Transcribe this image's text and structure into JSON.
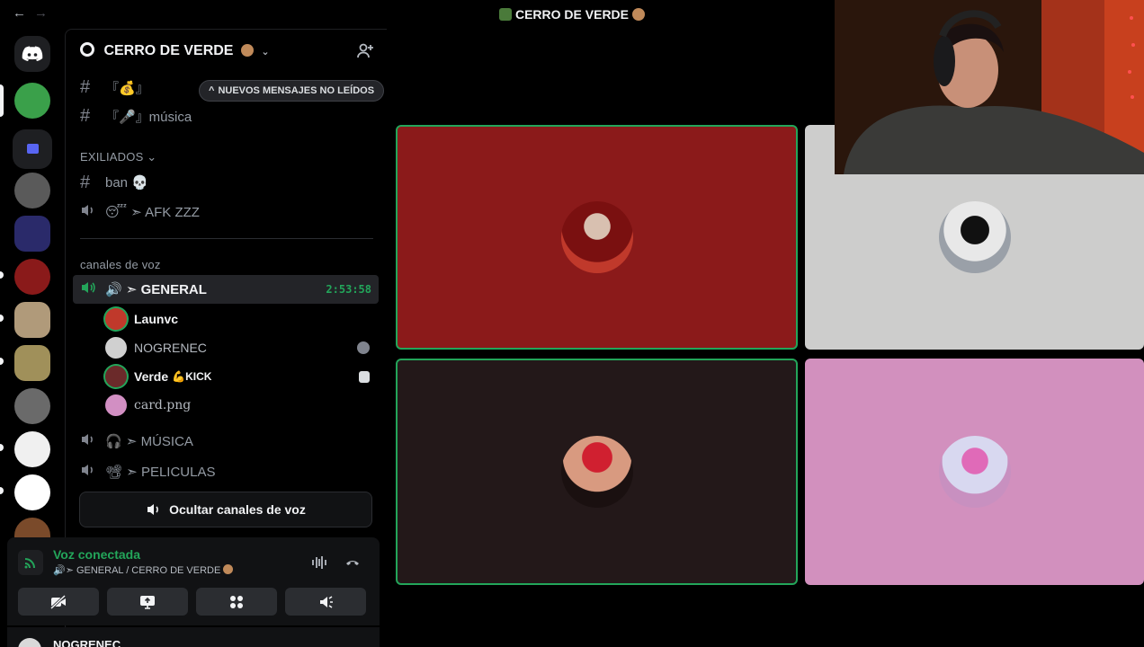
{
  "nav": {
    "back": "←",
    "forward": "→"
  },
  "window": {
    "title": "CERRO DE VERDE"
  },
  "guild": {
    "name": "CERRO DE VERDE",
    "chevron": "⌄"
  },
  "unread_pill": {
    "label": "NUEVOS MENSAJES NO LEÍDOS",
    "arrow": "^"
  },
  "channels": {
    "top": [
      {
        "prefix": "#",
        "label": "『💰』"
      },
      {
        "prefix": "#",
        "label": "『🎤』música"
      }
    ],
    "category_exiliados": "EXILIADOS ⌄",
    "exiliados": [
      {
        "prefix": "#",
        "label": "ban 💀"
      },
      {
        "label": "😴 ➣ AFK ZZZ"
      }
    ],
    "category_voz": "canales de voz",
    "voice_general": {
      "label": "🔊 ➣ GENERAL",
      "timer": "2:53:58"
    },
    "voice_users": [
      {
        "name": "Launvc",
        "style": "bold",
        "color": "#c0392b"
      },
      {
        "name": "NOGRENEC",
        "style": "dim",
        "color": "#d0d0d0"
      },
      {
        "name": "Verde",
        "style": "bold",
        "tag": "KICK",
        "tag_icon": "💪",
        "color": "#6b2a2a"
      },
      {
        "name": "card.png",
        "style": "dim",
        "color": "#d28fc3"
      }
    ],
    "voice_musica": "🎧 ➣ MÚSICA",
    "voice_peliculas": "📽 ➣ PELICULAS",
    "hide_voice": "Ocultar canales de voz"
  },
  "voice_panel": {
    "title": "Voz conectada",
    "subtitle": "🔊➣ GENERAL / CERRO DE VERDE"
  },
  "user_panel": {
    "name": "NOGRENEC"
  },
  "tiles": [
    {
      "bg": "#8b1a1a",
      "speaking": true,
      "avatar": "#c0392b"
    },
    {
      "bg": "#cdcdcc",
      "speaking": false,
      "avatar": "#2b2b2b"
    },
    {
      "bg": "#231819",
      "speaking": true,
      "avatar": "#b06050"
    },
    {
      "bg": "#d290be",
      "speaking": false,
      "avatar": "#c8b8e0"
    }
  ],
  "colors": {
    "green": "#23a55a",
    "blurple": "#5865f2"
  }
}
